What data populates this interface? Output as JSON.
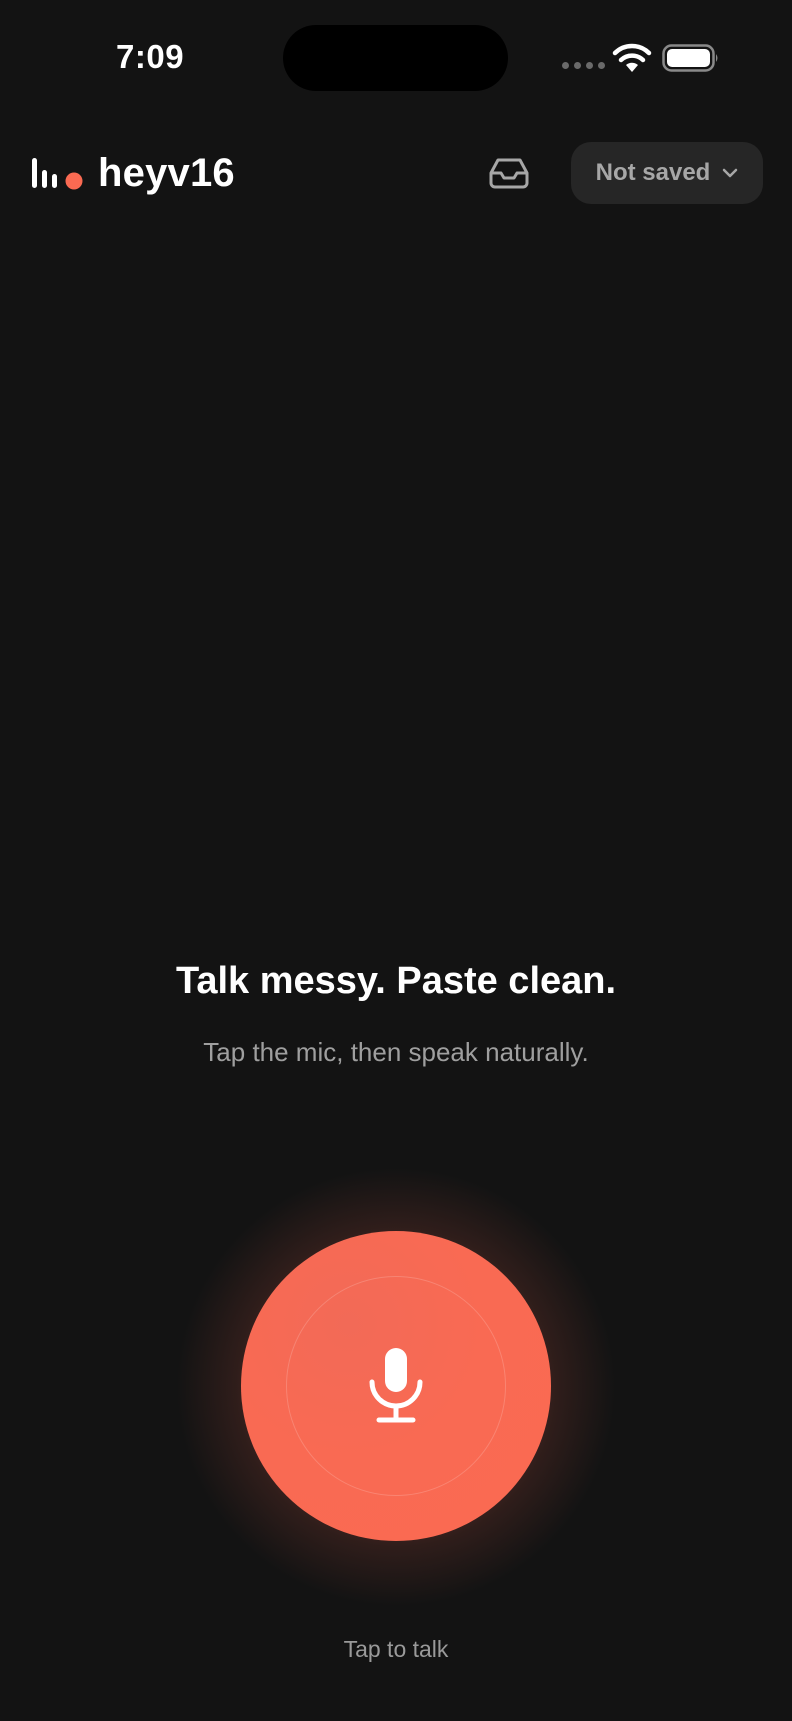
{
  "status_bar": {
    "time": "7:09"
  },
  "header": {
    "brand_name": "heyv16",
    "logo_icon": "audio-bars-with-dot-icon",
    "inbox_icon": "inbox-tray-icon",
    "save_state": "Not saved",
    "save_state_icon": "chevron-down-icon"
  },
  "hero": {
    "headline": "Talk messy. Paste clean.",
    "subline": "Tap the mic, then speak naturally."
  },
  "mic": {
    "icon": "microphone-icon",
    "label": "Tap to talk"
  },
  "colors": {
    "background": "#131313",
    "accent": "#FA6A52",
    "chip_background": "#262626",
    "muted_text": "#9F9F9F"
  }
}
